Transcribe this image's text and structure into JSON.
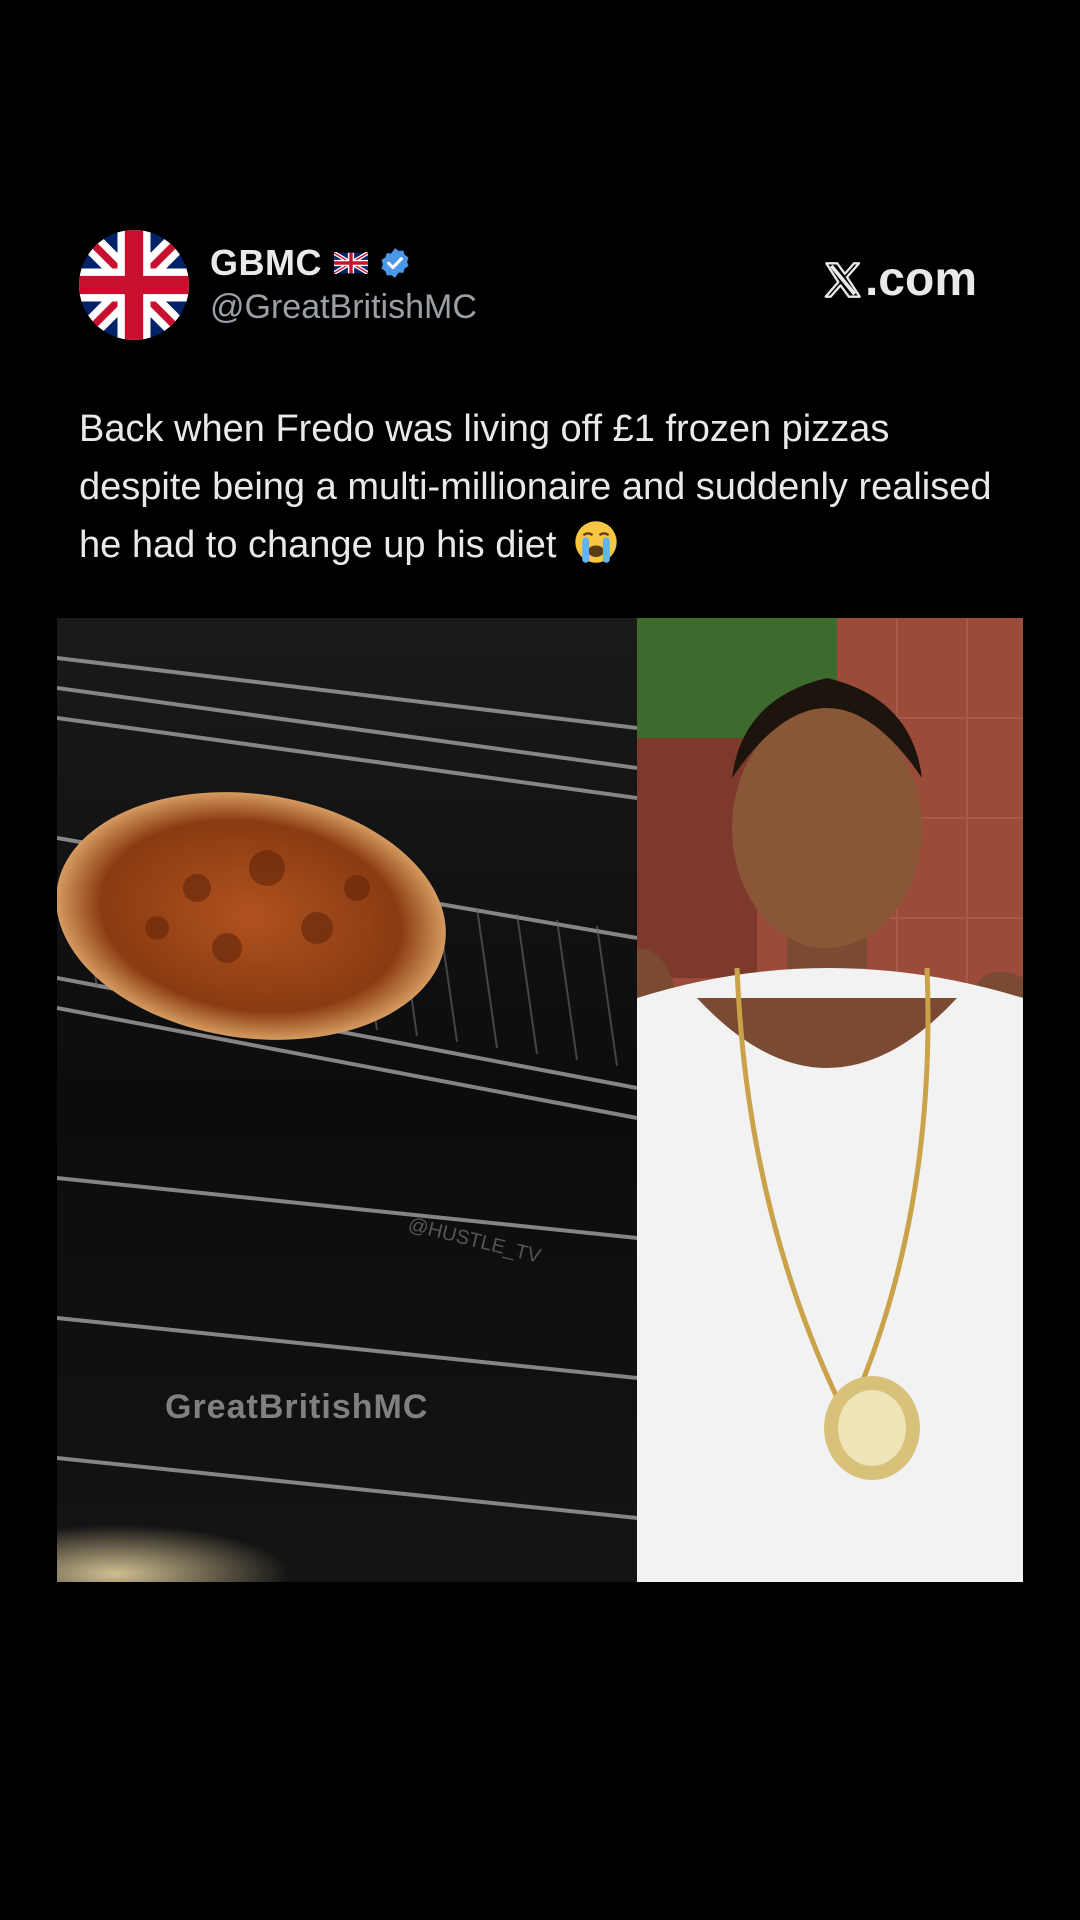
{
  "author": {
    "display_name": "GBMC",
    "handle": "@GreatBritishMC",
    "avatar_icon": "union-jack-flag-icon",
    "name_flag_icon": "uk-flag-icon",
    "verified_icon": "verified-badge-icon",
    "verified_color": "#4a99e9"
  },
  "brand": {
    "text": ".com",
    "icon": "x-logo-icon"
  },
  "post": {
    "text": "Back when Fredo was living off £1 frozen pizzas despite being a multi-millionaire and suddenly realised he had to change up his diet",
    "emoji": "loudly-crying-face-icon"
  },
  "media": {
    "left_image": "pizza-in-oven-photo",
    "right_image": "man-in-white-vest-with-chain-photo",
    "watermark_text": "GreatBritishMC",
    "overlay_text": "@HUSTLE_TV"
  },
  "colors": {
    "background": "#000000",
    "text_primary": "#e7e9ea",
    "text_secondary": "#9aa0a6"
  }
}
